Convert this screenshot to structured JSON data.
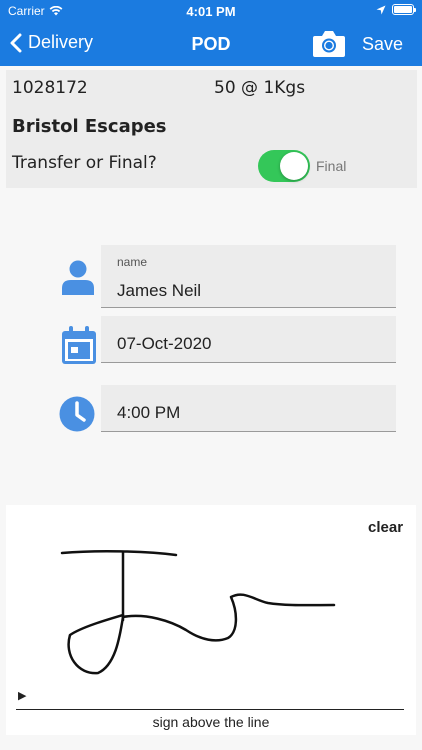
{
  "status_bar": {
    "carrier": "Carrier",
    "time": "4:01 PM",
    "icons": [
      "wifi-icon",
      "location-arrow-icon",
      "battery-icon"
    ]
  },
  "nav": {
    "back_label": "Delivery",
    "title": "POD",
    "save_label": "Save",
    "icons": [
      "chevron-left-icon",
      "camera-icon"
    ]
  },
  "info": {
    "order_id": "1028172",
    "quantity": "50 @ 1Kgs",
    "customer": "Bristol Escapes",
    "transfer_label": "Transfer or Final?",
    "toggle_on": true,
    "toggle_state_label": "Final"
  },
  "form": {
    "name_caption": "name",
    "name_value": "James Neil",
    "date_value": "07-Oct-2020",
    "time_value": "4:00 PM",
    "icons": [
      "person-icon",
      "calendar-icon",
      "clock-icon"
    ]
  },
  "signature": {
    "clear_label": "clear",
    "arrow": "▶",
    "instruction": "sign above the line"
  },
  "colors": {
    "brand_blue": "#1b7be0",
    "icon_blue": "#4a90e2",
    "toggle_green": "#34c759"
  }
}
